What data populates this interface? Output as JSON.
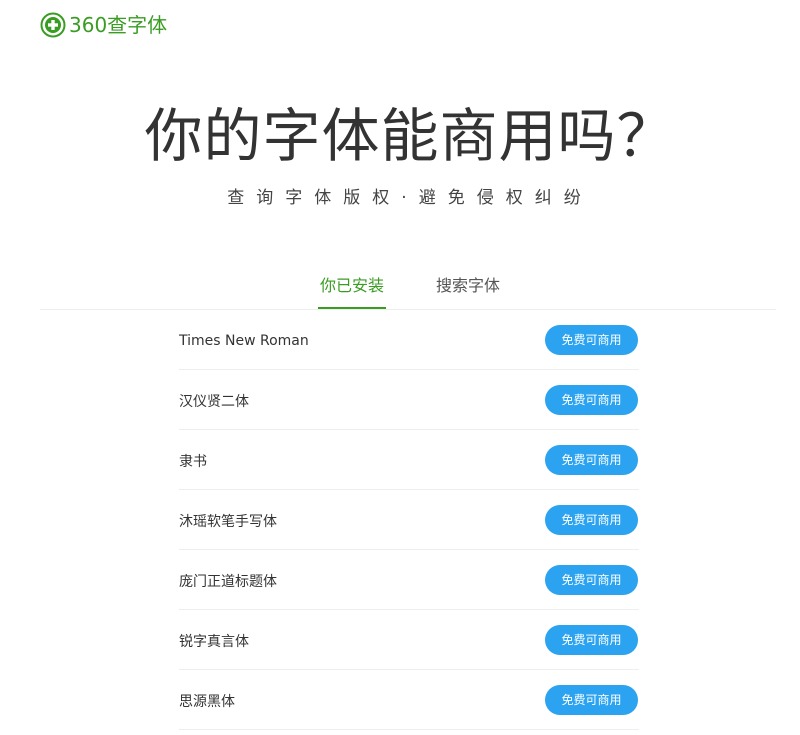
{
  "header": {
    "logo_text": "360查字体",
    "logo_icon": "green-circle-plus-icon",
    "brand_color": "#3a9d23"
  },
  "hero": {
    "title": "你的字体能商用吗？",
    "subtitle": "查询字体版权·避免侵权纠纷"
  },
  "tabs": [
    {
      "label": "你已安装",
      "active": true
    },
    {
      "label": "搜索字体",
      "active": false
    }
  ],
  "fonts": [
    {
      "name": "Times New Roman",
      "status": "免费可商用"
    },
    {
      "name": "汉仪贤二体",
      "status": "免费可商用"
    },
    {
      "name": "隶书",
      "status": "免费可商用"
    },
    {
      "name": "沐瑶软笔手写体",
      "status": "免费可商用"
    },
    {
      "name": "庞门正道标题体",
      "status": "免费可商用"
    },
    {
      "name": "锐字真言体",
      "status": "免费可商用"
    },
    {
      "name": "思源黑体",
      "status": "免费可商用"
    }
  ],
  "colors": {
    "accent": "#3a9d23",
    "button": "#2ba3f1",
    "divider": "#eeeeee"
  }
}
